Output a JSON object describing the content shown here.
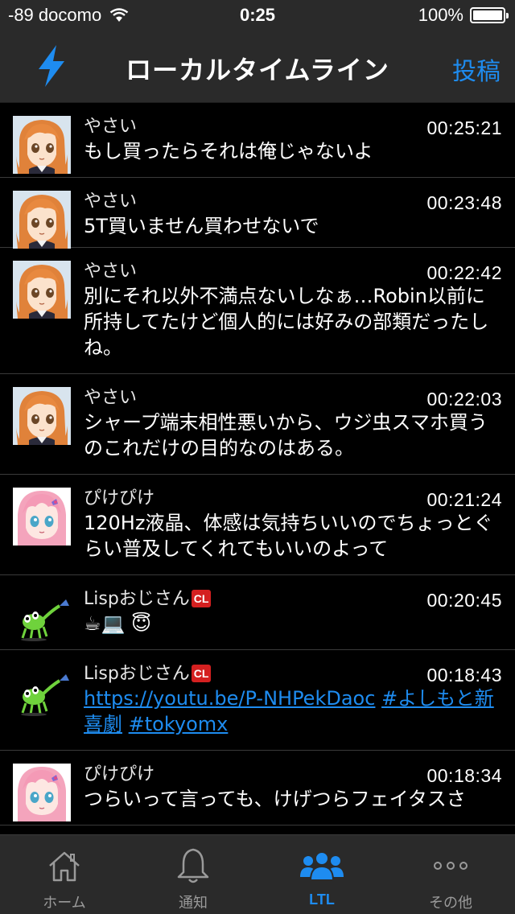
{
  "status": {
    "carrier": "-89 docomo",
    "time": "0:25",
    "battery": "100%"
  },
  "nav": {
    "title": "ローカルタイムライン",
    "right_button": "投稿",
    "left_icon": "lightning-icon"
  },
  "colors": {
    "accent": "#1e8cf0",
    "bar_bg": "#2a2a2a",
    "background": "#000000"
  },
  "toots": [
    {
      "name": "やさい",
      "time": "00:25:21",
      "content": "もし買ったらそれは俺じゃないよ",
      "avatar": "orange-hair-avatar"
    },
    {
      "name": "やさい",
      "time": "00:23:48",
      "content": "5T買いません買わせないで",
      "avatar": "orange-hair-avatar"
    },
    {
      "name": "やさい",
      "time": "00:22:42",
      "content": "別にそれ以外不満点ないしなぁ…Robin以前に所持してたけど個人的には好みの部類だったしね。",
      "avatar": "orange-hair-avatar"
    },
    {
      "name": "やさい",
      "time": "00:22:03",
      "content": "シャープ端末相性悪いから、ウジ虫スマホ買うのこれだけの目的なのはある。",
      "avatar": "orange-hair-avatar"
    },
    {
      "name": "ぴけぴけ",
      "time": "00:21:24",
      "content": "120Hz液晶、体感は気持ちいいのでちょっとぐらい普及してくれてもいいのよって",
      "avatar": "pink-hair-avatar"
    },
    {
      "name": "Lispおじさん",
      "badge": "CL",
      "time": "00:20:45",
      "content": "☕💻 😇",
      "avatar": "lisp-alien-avatar"
    },
    {
      "name": "Lispおじさん",
      "badge": "CL",
      "time": "00:18:43",
      "link": "https://youtu.be/P-NHPekDaoc",
      "hashtag1": "#よしもと新喜劇",
      "hashtag2": "#tokyomx",
      "avatar": "lisp-alien-avatar"
    },
    {
      "name": "ぴけぴけ",
      "time": "00:18:34",
      "content": "つらいって言っても、けげつらフェイタスさ",
      "avatar": "pink-hair-avatar"
    }
  ],
  "tabs": [
    {
      "label": "ホーム",
      "icon": "home-icon",
      "active": false
    },
    {
      "label": "通知",
      "icon": "bell-icon",
      "active": false
    },
    {
      "label": "LTL",
      "icon": "people-icon",
      "active": true
    },
    {
      "label": "その他",
      "icon": "more-icon",
      "active": false
    }
  ]
}
